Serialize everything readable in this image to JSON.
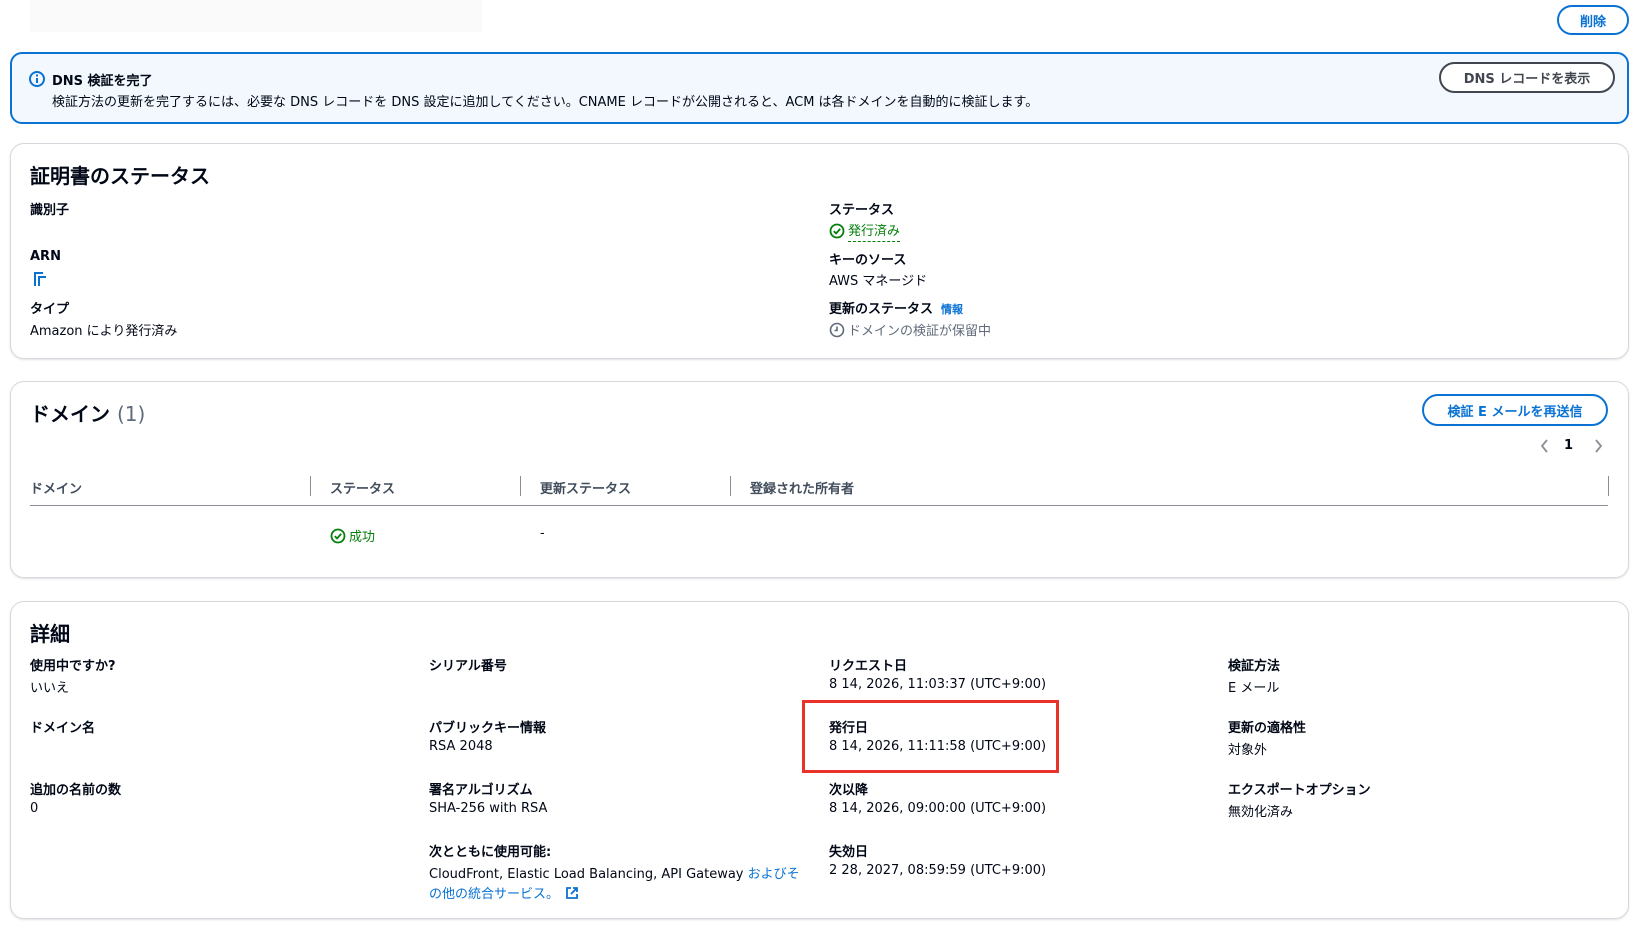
{
  "header": {
    "delete_label": "削除"
  },
  "alert": {
    "title": "DNS 検証を完了",
    "body": "検証方法の更新を完了するには、必要な DNS レコードを DNS 設定に追加してください。CNAME レコードが公開されると、ACM は各ドメインを自動的に検証します。",
    "button_label": "DNS レコードを表示"
  },
  "cert_status": {
    "title": "証明書のステータス",
    "identifier_label": "識別子",
    "arn_label": "ARN",
    "type_label": "タイプ",
    "type_value": "Amazon により発行済み",
    "status_label": "ステータス",
    "status_value": "発行済み",
    "key_source_label": "キーのソース",
    "key_source_value": "AWS マネージド",
    "renewal_status_label": "更新のステータス",
    "info_link": "情報",
    "renewal_status_value": "ドメインの検証が保留中"
  },
  "domains": {
    "title": "ドメイン",
    "count": "(1)",
    "resend_button": "検証 E メールを再送信",
    "page": "1",
    "columns": [
      "ドメイン",
      "ステータス",
      "更新ステータス",
      "登録された所有者"
    ],
    "rows": [
      {
        "domain": "",
        "status": "成功",
        "renewal_status": "-",
        "owner": ""
      }
    ]
  },
  "details": {
    "title": "詳細",
    "in_use_label": "使用中ですか?",
    "in_use_value": "いいえ",
    "domain_name_label": "ドメイン名",
    "additional_names_label": "追加の名前の数",
    "additional_names_value": "0",
    "serial_label": "シリアル番号",
    "public_key_label": "パブリックキー情報",
    "public_key_value": "RSA 2048",
    "signature_label": "署名アルゴリズム",
    "signature_value": "SHA-256 with RSA",
    "usable_with_label": "次とともに使用可能:",
    "usable_with_value": "CloudFront, Elastic Load Balancing, API Gateway",
    "usable_with_link_1": "およびそ",
    "usable_with_link_2": "の他の統合サービス。",
    "requested_label": "リクエスト日",
    "requested_value": "8 14, 2026, 11:03:37 (UTC+9:00)",
    "issued_label": "発行日",
    "issued_value": "8 14, 2026, 11:11:58 (UTC+9:00)",
    "not_before_label": "次以降",
    "not_before_value": "8 14, 2026, 09:00:00 (UTC+9:00)",
    "expires_label": "失効日",
    "expires_value": "2 28, 2027, 08:59:59 (UTC+9:00)",
    "validation_label": "検証方法",
    "validation_value": "E メール",
    "renewal_eligibility_label": "更新の適格性",
    "renewal_eligibility_value": "対象外",
    "export_label": "エクスポートオプション",
    "export_value": "無効化済み"
  },
  "colors": {
    "accent": "#0972d3",
    "success": "#037f0c",
    "highlight": "#e8322a",
    "alert_bg": "#f2f8fd"
  }
}
